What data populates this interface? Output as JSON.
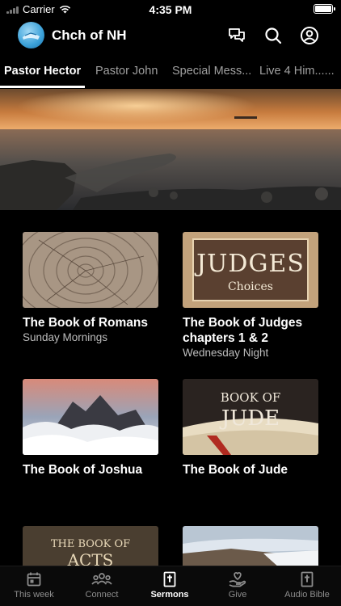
{
  "status_bar": {
    "carrier": "Carrier",
    "time": "4:35 PM"
  },
  "header": {
    "title": "Chch of NH",
    "icons": [
      "logo",
      "chat-icon",
      "search-icon",
      "profile-icon"
    ]
  },
  "tabs": [
    {
      "label": "Pastor Hector",
      "active": true
    },
    {
      "label": "Pastor John",
      "active": false
    },
    {
      "label": "Special Mess...",
      "active": false
    },
    {
      "label": "Live 4 Him......",
      "active": false
    }
  ],
  "sermons": [
    {
      "title": "The Book of Romans",
      "subtitle": "Sunday Mornings"
    },
    {
      "title": "The Book of Judges chapters 1 & 2",
      "subtitle": "Wednesday Night",
      "thumb_text": "JUDGES",
      "thumb_subtext": "Choices"
    },
    {
      "title": "The Book of Joshua",
      "subtitle": ""
    },
    {
      "title": "The Book of Jude",
      "subtitle": "",
      "thumb_text_1": "BOOK OF",
      "thumb_text_2": "JUDE"
    },
    {
      "title": "",
      "subtitle": "",
      "thumb_text_1": "THE BOOK OF",
      "thumb_text_2": "ACTS"
    },
    {
      "title": "",
      "subtitle": ""
    }
  ],
  "bottom_nav": [
    {
      "label": "This week",
      "icon": "calendar-icon",
      "active": false
    },
    {
      "label": "Connect",
      "icon": "people-icon",
      "active": false
    },
    {
      "label": "Sermons",
      "icon": "bible-icon",
      "active": true
    },
    {
      "label": "Give",
      "icon": "give-hand-icon",
      "active": false
    },
    {
      "label": "Audio Bible",
      "icon": "audio-bible-icon",
      "active": false
    }
  ],
  "colors": {
    "background": "#000000",
    "inactive": "#8d8d8d",
    "active": "#ffffff"
  }
}
